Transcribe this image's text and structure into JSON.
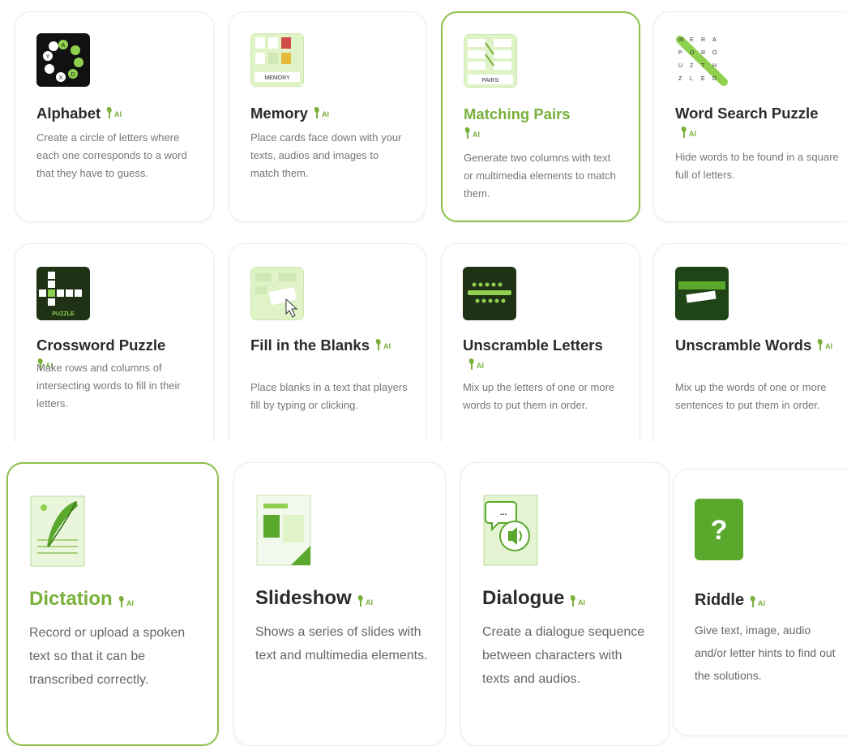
{
  "cards": [
    {
      "title": "Alphabet",
      "desc": "Create a circle of letters where each one corresponds to a word that they have to guess.",
      "icon": "alphabet-icon"
    },
    {
      "title": "Memory",
      "desc": "Place cards face down with your texts, audios and images to match them.",
      "icon": "memory-icon",
      "icon_text": "MEMORY"
    },
    {
      "title": "Matching Pairs",
      "desc": "Generate two columns with text or multimedia elements to match them.",
      "icon": "matching-pairs-icon",
      "icon_text": "PAIRS",
      "selected": true
    },
    {
      "title": "Word Search Puzzle",
      "desc": "Hide words to be found in a square full of letters.",
      "icon": "word-search-icon"
    },
    {
      "title": "Crossword Puzzle",
      "desc": "Make rows and columns of intersecting words to fill in their letters.",
      "icon": "crossword-icon",
      "icon_text": "PUZZLE"
    },
    {
      "title": "Fill in the Blanks",
      "desc": "Place blanks in a text that players fill by typing or clicking.",
      "icon": "fill-blanks-icon"
    },
    {
      "title": "Unscramble Letters",
      "desc": "Mix up the letters of one or more words to put them in order.",
      "icon": "unscramble-letters-icon"
    },
    {
      "title": "Unscramble Words",
      "desc": "Mix up the words of one or more sentences to put them in order.",
      "icon": "unscramble-words-icon"
    },
    {
      "title": "Dictation",
      "desc": "Record or upload a spoken text so that it can be transcribed correctly.",
      "icon": "quill-icon",
      "selected": true
    },
    {
      "title": "Slideshow",
      "desc": "Shows a series of slides with text and multimedia elements.",
      "icon": "slideshow-icon"
    },
    {
      "title": "Dialogue",
      "desc": "Create a dialogue sequence between characters with texts and audios.",
      "icon": "dialogue-icon"
    },
    {
      "title": "Riddle",
      "desc": "Give text, image, audio and/or letter hints to find out the solutions.",
      "icon": "riddle-icon",
      "icon_text": "?"
    }
  ],
  "badge_text": "AI",
  "colors": {
    "accent": "#7ab03c",
    "icon_dark": "#1d3a10",
    "icon_light": "#dff3c6",
    "icon_green": "#5aa82c"
  }
}
